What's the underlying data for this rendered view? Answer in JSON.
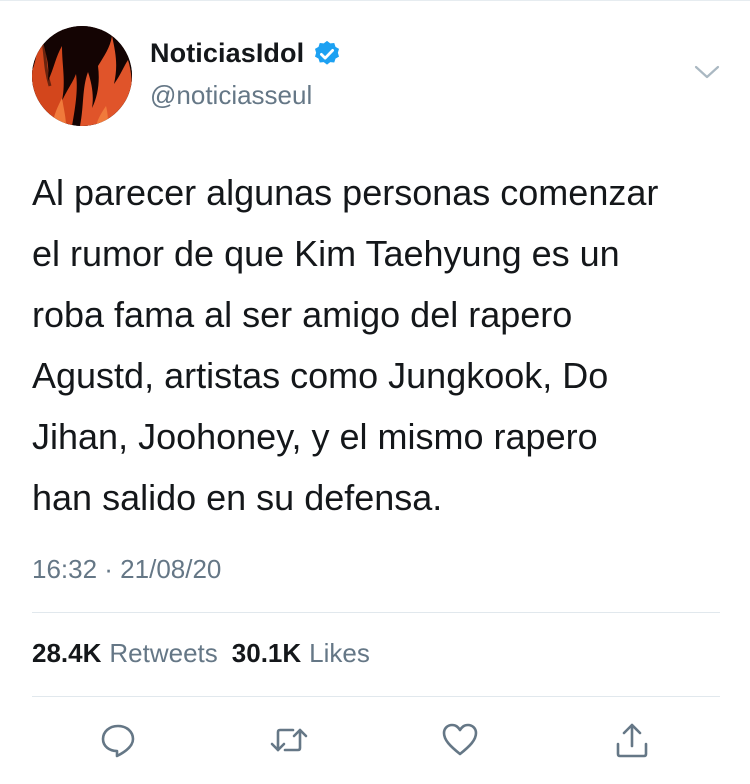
{
  "author": {
    "display_name": "NoticiasIdol",
    "handle": "@noticiasseul",
    "verified_icon": "verified-badge-icon",
    "avatar_icon": "flame-avatar"
  },
  "tweet": {
    "text": "Al parecer algunas personas comenzar\nel rumor de que Kim Taehyung es un\nroba fama al ser amigo del rapero\nAgustd, artistas como Jungkook, Do\nJihan, Joohoney, y el mismo rapero\nhan salido en su defensa.",
    "timestamp": "16:32 · 21/08/20"
  },
  "stats": {
    "retweets_count": "28.4K",
    "retweets_label": "Retweets",
    "likes_count": "30.1K",
    "likes_label": "Likes"
  },
  "actions": [
    "reply-icon",
    "retweet-icon",
    "like-icon",
    "share-icon"
  ],
  "colors": {
    "text": "#14171a",
    "secondary": "#657786",
    "divider": "#e1e8ed",
    "verified": "#1da1f2"
  }
}
